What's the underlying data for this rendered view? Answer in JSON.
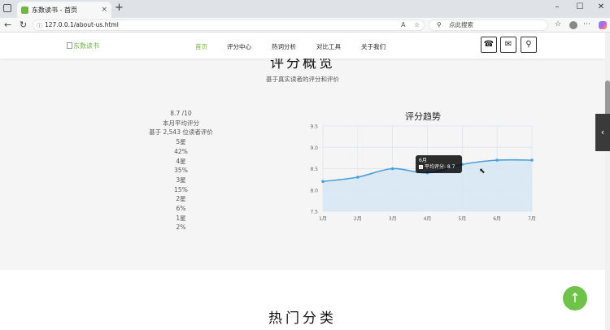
{
  "browser": {
    "tab_title": "东数读书 - 首页",
    "url": "127.0.0.1/about-us.html",
    "search_placeholder": "点此搜索",
    "new_tab": "+"
  },
  "nav": {
    "logo_alt": "东数读书",
    "items": [
      "首页",
      "评分中心",
      "热词分析",
      "对比工具",
      "关于我们"
    ],
    "active_index": 0
  },
  "rating": {
    "title": "评分概览",
    "subtitle": "基于真实读者的评分和评价",
    "score": "8.7 /10",
    "avg_label": "本月平均评分",
    "based_on": "基于 2,543 位读者评价",
    "distribution": [
      {
        "star": "5星",
        "pct": "42%"
      },
      {
        "star": "4星",
        "pct": "35%"
      },
      {
        "star": "3星",
        "pct": "15%"
      },
      {
        "star": "2星",
        "pct": "6%"
      },
      {
        "star": "1星",
        "pct": "2%"
      }
    ]
  },
  "chart_data": {
    "type": "line",
    "title": "评分趋势",
    "categories": [
      "1月",
      "2月",
      "3月",
      "4月",
      "5月",
      "6月",
      "7月"
    ],
    "series": [
      {
        "name": "平均评分",
        "values": [
          8.2,
          8.3,
          8.5,
          8.4,
          8.6,
          8.7,
          8.7
        ]
      }
    ],
    "ylim": [
      7.5,
      9.5
    ],
    "yticks": [
      "9.5",
      "9.0",
      "8.5",
      "8.0",
      "7.5"
    ],
    "grid": true,
    "color": "#4a9fd8",
    "fill": "#d6e6f3"
  },
  "tooltip": {
    "title": "6月",
    "text": "平均评分: 8.7"
  },
  "hot": {
    "title": "热门分类"
  },
  "icons": {
    "phone": "☎",
    "mail": "✉",
    "location": "⚲",
    "back_to_top": "↑",
    "side_tab": "‹"
  }
}
